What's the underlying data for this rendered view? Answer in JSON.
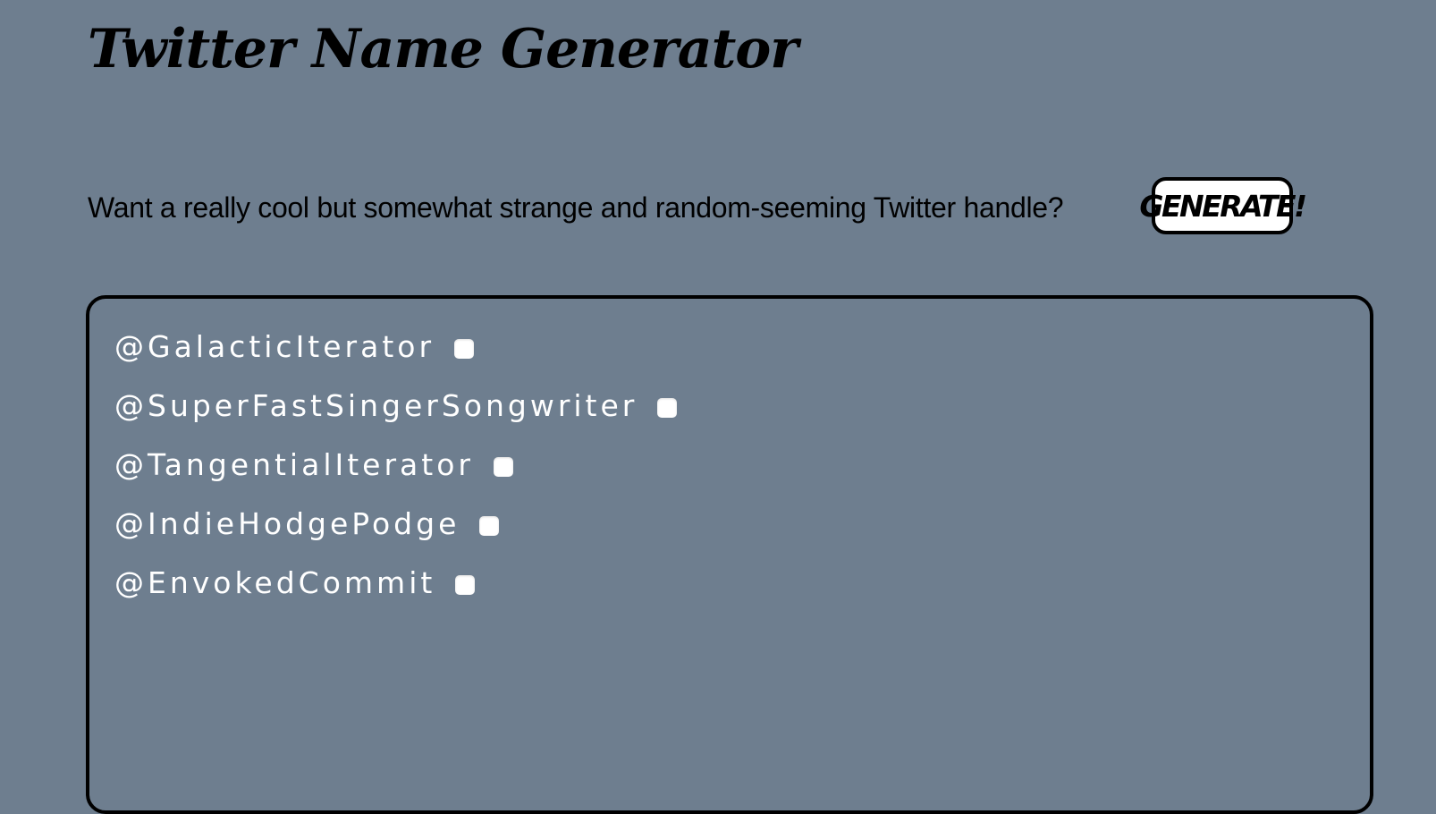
{
  "header": {
    "title": "Twitter Name Generator"
  },
  "prompt": {
    "text": "Want a really cool but somewhat strange and random-seeming Twitter handle?",
    "button_label": "GENERATE!"
  },
  "results": {
    "handles": [
      {
        "name": "@GalacticIterator",
        "checked": false
      },
      {
        "name": "@SuperFastSingerSongwriter",
        "checked": false
      },
      {
        "name": "@TangentialIterator",
        "checked": false
      },
      {
        "name": "@IndieHodgePodge",
        "checked": false
      },
      {
        "name": "@EnvokedCommit",
        "checked": false
      }
    ]
  },
  "colors": {
    "background": "#6e7e8f",
    "handle_text": "#ffffff",
    "button_bg": "#ffffff",
    "border": "#000000"
  }
}
